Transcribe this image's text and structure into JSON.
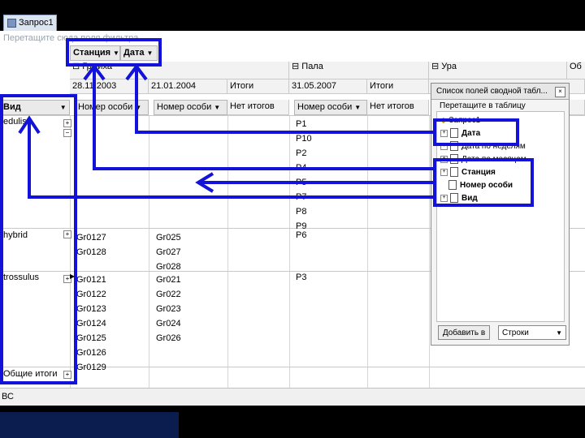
{
  "window": {
    "doc_tab": "Запрос1"
  },
  "pivot": {
    "filter_hint": "Перетащите сюда поля фильтра",
    "column_fields": [
      "Станция",
      "Дата"
    ],
    "stations": [
      {
        "name": "Грмиха",
        "dates": [
          "28.11.2003",
          "21.01.2004"
        ],
        "total": "Итоги"
      },
      {
        "name": "Пала",
        "dates": [
          "31.05.2007"
        ],
        "total": "Итоги"
      },
      {
        "name": "Ура"
      },
      {
        "name": "Об"
      }
    ],
    "row_field": "Вид",
    "data_field_label": "Номер особи",
    "no_total_label": "Нет итогов",
    "groups": [
      {
        "species": "edulis",
        "c1": [],
        "c2": [],
        "c3": [
          "P1",
          "P10",
          "P2",
          "P4",
          "P5",
          "P7",
          "P8",
          "P9",
          "P6"
        ]
      },
      {
        "species": "hybrid",
        "c1": [
          "Gr0127",
          "Gr0128"
        ],
        "c2": [
          "Gr025",
          "Gr027",
          "Gr028"
        ],
        "c3": []
      },
      {
        "species": "trossulus",
        "c1": [
          "Gr0121",
          "Gr0122",
          "Gr0123",
          "Gr0124",
          "Gr0125",
          "Gr0126",
          "Gr0129"
        ],
        "c2": [
          "Gr021",
          "Gr022",
          "Gr023",
          "Gr024",
          "Gr026"
        ],
        "c3": [
          "P3"
        ]
      }
    ],
    "grand_total": "Общие итоги"
  },
  "field_list": {
    "title": "Список полей сводной табл...",
    "hint": "Перетащите в таблицу",
    "root": "Запрос1",
    "items": [
      "Дата",
      "Дата по неделям",
      "Дата по месяцам",
      "Станция",
      "Номер особи",
      "Вид"
    ],
    "add_button": "Добавить в",
    "area_select": "Строки"
  },
  "status_bar": {
    "text": "ВС"
  },
  "colors": {
    "annotation": "#1212d8",
    "window_bg": "#ffffff",
    "header_bg": "#f2f2f2"
  }
}
